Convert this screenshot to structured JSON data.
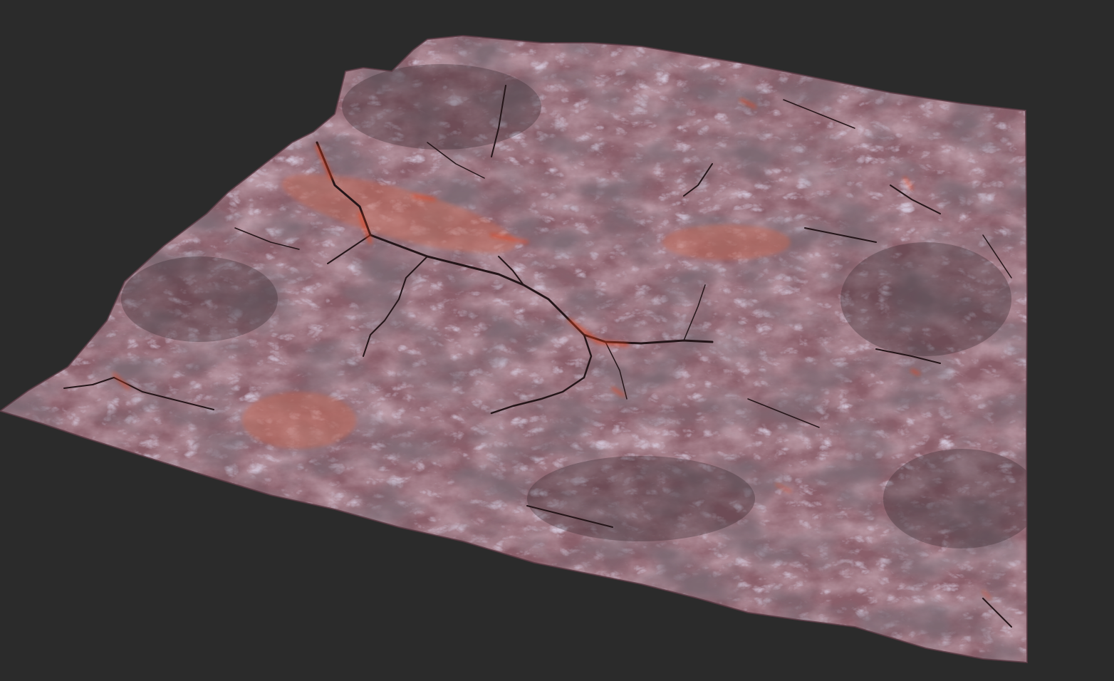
{
  "scene": {
    "background_color": "#2b2b2b",
    "subject": "terrain-heightmap-render",
    "palette": {
      "base": "#8a5f6a",
      "highlight": "#b08fa6",
      "ridge_light": "#a89bb8",
      "shadow": "#3a2a30",
      "channel": "#2a1a1c",
      "lava": "#e0401a",
      "sediment": "#c06a5a"
    }
  }
}
